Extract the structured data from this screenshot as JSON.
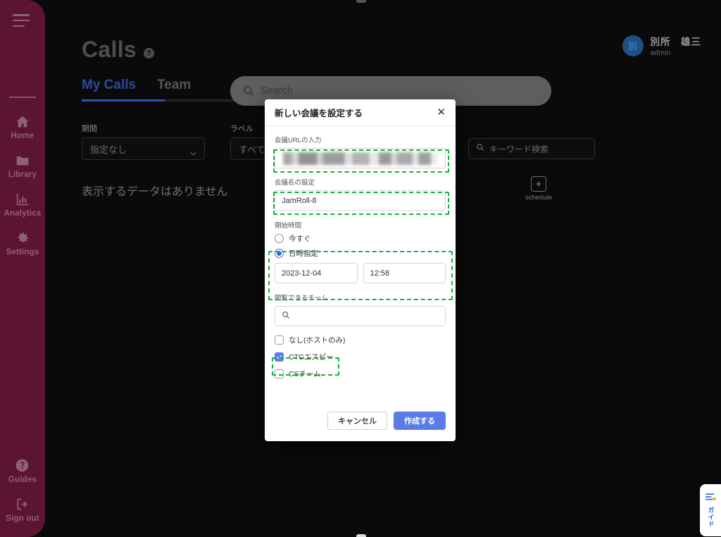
{
  "sidebar": {
    "menu_icon": "hamburger-icon",
    "items": [
      {
        "label": "Home",
        "icon": "home-icon"
      },
      {
        "label": "Library",
        "icon": "folder-icon"
      },
      {
        "label": "Analytics",
        "icon": "bar-chart-icon"
      },
      {
        "label": "Settings",
        "icon": "gear-icon"
      }
    ],
    "bottom_items": [
      {
        "label": "Guides",
        "icon": "question-circle-icon"
      },
      {
        "label": "Sign out",
        "icon": "sign-out-icon"
      }
    ],
    "bg_color": "#5c1433",
    "text_color": "#8d6374"
  },
  "header": {
    "title": "Calls",
    "help_badge": "?",
    "tabs": [
      {
        "label": "My Calls",
        "active": true
      },
      {
        "label": "Team",
        "active": false
      }
    ],
    "active_tab_color": "#2f52b0"
  },
  "top_search": {
    "placeholder": "Search",
    "icon": "search-icon"
  },
  "user": {
    "avatar_initial": "別",
    "name": "別所　雄三",
    "role": "admin",
    "avatar_color": "#1f4f84"
  },
  "filters": [
    {
      "label": "期間",
      "value": "指定なし",
      "icon": "chevron-down-icon"
    },
    {
      "label": "ラベル",
      "value": "すべて",
      "icon": "chevron-down-icon"
    }
  ],
  "keyword_search": {
    "placeholder": "キーワード検索",
    "icon": "search-icon"
  },
  "content": {
    "empty_message": "表示するデータはありません"
  },
  "schedule_button": {
    "icon": "plus-square-icon",
    "glyph": "+",
    "label": "schedule"
  },
  "modal": {
    "title": "新しい会議を設定する",
    "close_icon": "close-icon",
    "url_field": {
      "label": "会議URLの入力",
      "value": "",
      "redacted": true,
      "highlighted": true
    },
    "name_field": {
      "label": "会議名の設定",
      "value": "JamRoll-8",
      "highlighted": true
    },
    "start_time": {
      "label": "開始時間",
      "options": [
        {
          "label": "今すぐ",
          "selected": false
        },
        {
          "label": "日時指定",
          "selected": true
        }
      ],
      "date_value": "2023-12-04",
      "time_value": "12:58",
      "highlighted": true
    },
    "teams": {
      "label": "閲覧できるチーム",
      "search_placeholder": "",
      "search_icon": "search-icon",
      "options": [
        {
          "label": "なし(ホストのみ)",
          "checked": false,
          "highlighted": false
        },
        {
          "label": "CTCエスピー",
          "checked": true,
          "highlighted": true
        },
        {
          "label": "CSチーム",
          "checked": false,
          "highlighted": false
        }
      ]
    },
    "buttons": {
      "cancel": "キャンセル",
      "create": "作成する",
      "create_color": "#5b7ce8"
    }
  },
  "guide_widget": {
    "label": "ガイド",
    "icon": "guide-icon",
    "accent": "#2a6bd8"
  }
}
